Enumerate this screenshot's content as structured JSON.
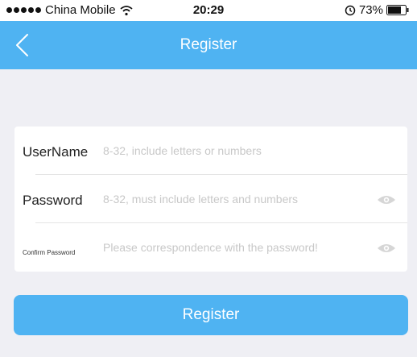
{
  "status_bar": {
    "carrier": "China Mobile",
    "time": "20:29",
    "battery": "73%"
  },
  "nav": {
    "title": "Register",
    "back_icon": "chevron-left-icon"
  },
  "form": {
    "username": {
      "label": "UserName",
      "value": "",
      "placeholder": "8-32, include letters or numbers"
    },
    "password": {
      "label": "Password",
      "value": "",
      "placeholder": "8-32, must include letters and numbers",
      "toggle_icon": "eye-icon"
    },
    "confirm": {
      "label": "Confirm Password",
      "value": "",
      "placeholder": "Please correspondence with the password!",
      "toggle_icon": "eye-icon"
    }
  },
  "submit": {
    "label": "Register"
  },
  "colors": {
    "accent": "#4fb3f2",
    "background": "#efeff4",
    "placeholder": "#c8c8c8"
  }
}
